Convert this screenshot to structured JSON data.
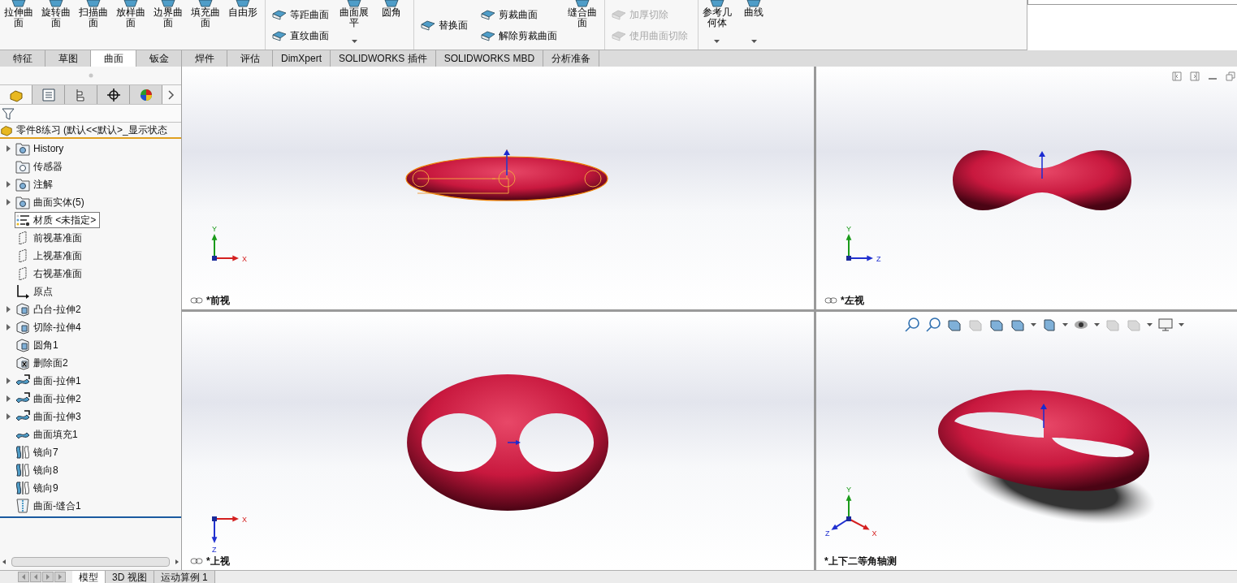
{
  "ribbon": [
    {
      "kind": "large",
      "label": "拉伸曲面"
    },
    {
      "kind": "large",
      "label": "旋转曲面"
    },
    {
      "kind": "large",
      "label": "扫描曲面"
    },
    {
      "kind": "large",
      "label": "放样曲面"
    },
    {
      "kind": "large",
      "label": "边界曲面"
    },
    {
      "kind": "large",
      "label": "填充曲面"
    },
    {
      "kind": "large",
      "label": "自由形"
    },
    {
      "kind": "stack",
      "items": [
        {
          "label": "等距曲面",
          "disabled": false
        },
        {
          "label": "直纹曲面",
          "disabled": false
        }
      ]
    },
    {
      "kind": "large",
      "label": "曲面展平",
      "dropdown": true
    },
    {
      "kind": "large",
      "label": "圆角"
    },
    {
      "kind": "stack",
      "items": [
        {
          "label": "替换面",
          "disabled": false
        }
      ]
    },
    {
      "kind": "stack",
      "items": [
        {
          "label": "剪裁曲面",
          "disabled": false
        },
        {
          "label": "解除剪裁曲面",
          "disabled": false
        }
      ]
    },
    {
      "kind": "large",
      "label": "缝合曲面"
    },
    {
      "kind": "stack",
      "items": [
        {
          "label": "加厚切除",
          "disabled": true
        },
        {
          "label": "使用曲面切除",
          "disabled": true
        }
      ]
    },
    {
      "kind": "large",
      "label": "参考几何体",
      "dropdown": true
    },
    {
      "kind": "large",
      "label": "曲线",
      "dropdown": true
    }
  ],
  "tabs": [
    {
      "label": "特征",
      "selected": false
    },
    {
      "label": "草图",
      "selected": false
    },
    {
      "label": "曲面",
      "selected": true
    },
    {
      "label": "钣金",
      "selected": false
    },
    {
      "label": "焊件",
      "selected": false
    },
    {
      "label": "评估",
      "selected": false
    },
    {
      "label": "DimXpert",
      "selected": false
    },
    {
      "label": "SOLIDWORKS 插件",
      "selected": false
    },
    {
      "label": "SOLIDWORKS MBD",
      "selected": false
    },
    {
      "label": "分析准备",
      "selected": false
    }
  ],
  "feature_tree": {
    "root": "零件8练习  (默认<<默认>_显示状态",
    "items": [
      {
        "label": "History",
        "kind": "history",
        "expandable": true,
        "selected": false
      },
      {
        "label": "传感器",
        "kind": "sensor",
        "expandable": false,
        "selected": false
      },
      {
        "label": "注解",
        "kind": "annotation",
        "expandable": true,
        "selected": false
      },
      {
        "label": "曲面实体(5)",
        "kind": "bodies",
        "expandable": true,
        "selected": false
      },
      {
        "label": "材质 <未指定>",
        "kind": "material",
        "expandable": false,
        "selected": true
      },
      {
        "label": "前视基准面",
        "kind": "plane",
        "expandable": false,
        "selected": false
      },
      {
        "label": "上视基准面",
        "kind": "plane",
        "expandable": false,
        "selected": false
      },
      {
        "label": "右视基准面",
        "kind": "plane",
        "expandable": false,
        "selected": false
      },
      {
        "label": "原点",
        "kind": "origin",
        "expandable": false,
        "selected": false
      },
      {
        "label": "凸台-拉伸2",
        "kind": "boss",
        "expandable": true,
        "selected": false
      },
      {
        "label": "切除-拉伸4",
        "kind": "cut",
        "expandable": true,
        "selected": false
      },
      {
        "label": "圆角1",
        "kind": "fillet",
        "expandable": false,
        "selected": false
      },
      {
        "label": "删除面2",
        "kind": "delete",
        "expandable": false,
        "selected": false
      },
      {
        "label": "曲面-拉伸1",
        "kind": "surface",
        "expandable": true,
        "selected": false
      },
      {
        "label": "曲面-拉伸2",
        "kind": "surface",
        "expandable": true,
        "selected": false
      },
      {
        "label": "曲面-拉伸3",
        "kind": "surface",
        "expandable": true,
        "selected": false
      },
      {
        "label": "曲面填充1",
        "kind": "fill",
        "expandable": false,
        "selected": false
      },
      {
        "label": "镜向7",
        "kind": "mirror",
        "expandable": false,
        "selected": false
      },
      {
        "label": "镜向8",
        "kind": "mirror",
        "expandable": false,
        "selected": false
      },
      {
        "label": "镜向9",
        "kind": "mirror",
        "expandable": false,
        "selected": false
      },
      {
        "label": "曲面-缝合1",
        "kind": "knit",
        "expandable": false,
        "selected": false
      }
    ]
  },
  "viewport_rows": [
    {
      "viewports": [
        {
          "label": "*前视",
          "kind": "front",
          "axes": [
            {
              "label": "Y",
              "kind": "up",
              "color": "#1a9a1a"
            },
            {
              "label": "X",
              "kind": "right",
              "color": "#d42020"
            }
          ]
        },
        {
          "label": "*左视",
          "kind": "left",
          "axes": [
            {
              "label": "Y",
              "kind": "up",
              "color": "#1a9a1a"
            },
            {
              "label": "Z",
              "kind": "right",
              "color": "#2030d0"
            }
          ]
        }
      ]
    },
    {
      "viewports": [
        {
          "label": "*上视",
          "kind": "top",
          "axes": [
            {
              "label": "X",
              "kind": "right",
              "color": "#d42020"
            },
            {
              "label": "Z",
              "kind": "down",
              "color": "#2030d0"
            }
          ]
        },
        {
          "label": "*上下二等角轴测",
          "kind": "iso",
          "axes": [
            {
              "label": "Y",
              "kind": "up",
              "color": "#1a9a1a"
            },
            {
              "label": "Z",
              "kind": "down-left",
              "color": "#2030d0"
            },
            {
              "label": "X",
              "kind": "down-right",
              "color": "#d42020"
            }
          ]
        }
      ]
    }
  ],
  "bottom_tabs": [
    {
      "label": "模型",
      "selected": true
    },
    {
      "label": "3D 视图",
      "selected": false
    },
    {
      "label": "运动算例 1",
      "selected": false
    }
  ]
}
